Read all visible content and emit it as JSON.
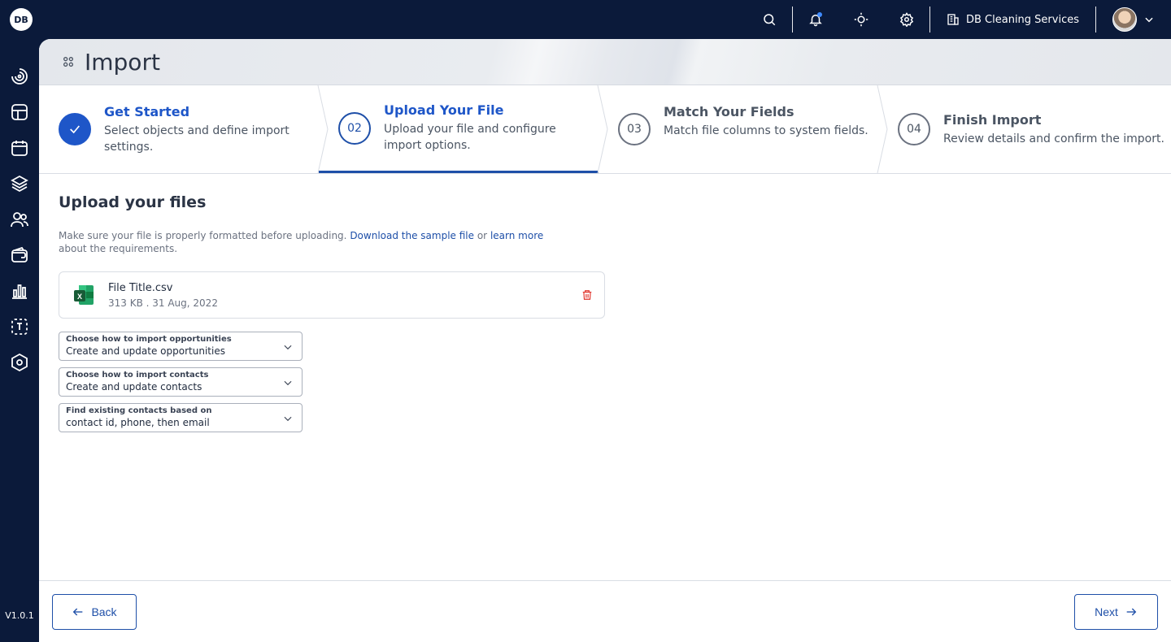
{
  "app": {
    "logo_text": "DB",
    "version": "V1.0.1"
  },
  "topbar": {
    "company_name": "DB Cleaning Services",
    "icons": [
      "search-icon",
      "bell-icon",
      "theme-icon",
      "settings-icon",
      "building-icon",
      "chevron-down-icon"
    ]
  },
  "sidebar": {
    "items": [
      "dashboard-icon",
      "layout-icon",
      "calendar-icon",
      "layers-icon",
      "users-icon",
      "wallet-icon",
      "chart-icon",
      "scan-icon",
      "hexagon-icon"
    ]
  },
  "header": {
    "title": "Import"
  },
  "steps": [
    {
      "number": "✓",
      "title": "Get Started",
      "desc": "Select objects and define import settings.",
      "state": "done"
    },
    {
      "number": "02",
      "title": "Upload Your File",
      "desc": "Upload your file and configure import options.",
      "state": "active"
    },
    {
      "number": "03",
      "title": "Match Your Fields",
      "desc": "Match file columns to system fields.",
      "state": "future"
    },
    {
      "number": "04",
      "title": "Finish Import",
      "desc": "Review details and confirm the import.",
      "state": "future"
    }
  ],
  "upload": {
    "title": "Upload your files",
    "help_prefix": "Make sure your file is properly formatted before uploading.",
    "link_sample": "Download the sample file",
    "help_or": "or",
    "link_learn": "learn more",
    "help_suffix": "about the requirements.",
    "file": {
      "name": "File Title.csv",
      "meta": "313 KB . 31 Aug, 2022"
    }
  },
  "selects": [
    {
      "label": "Choose how to import opportunities",
      "value": "Create and update opportunities"
    },
    {
      "label": "Choose how to import contacts",
      "value": "Create and update contacts"
    },
    {
      "label": "Find existing contacts based on",
      "value": "contact id, phone, then email"
    }
  ],
  "footer": {
    "back_label": "Back",
    "next_label": "Next"
  },
  "colors": {
    "navy": "#0b1a3a",
    "primary": "#1e4fa8",
    "danger": "#e0342b"
  }
}
